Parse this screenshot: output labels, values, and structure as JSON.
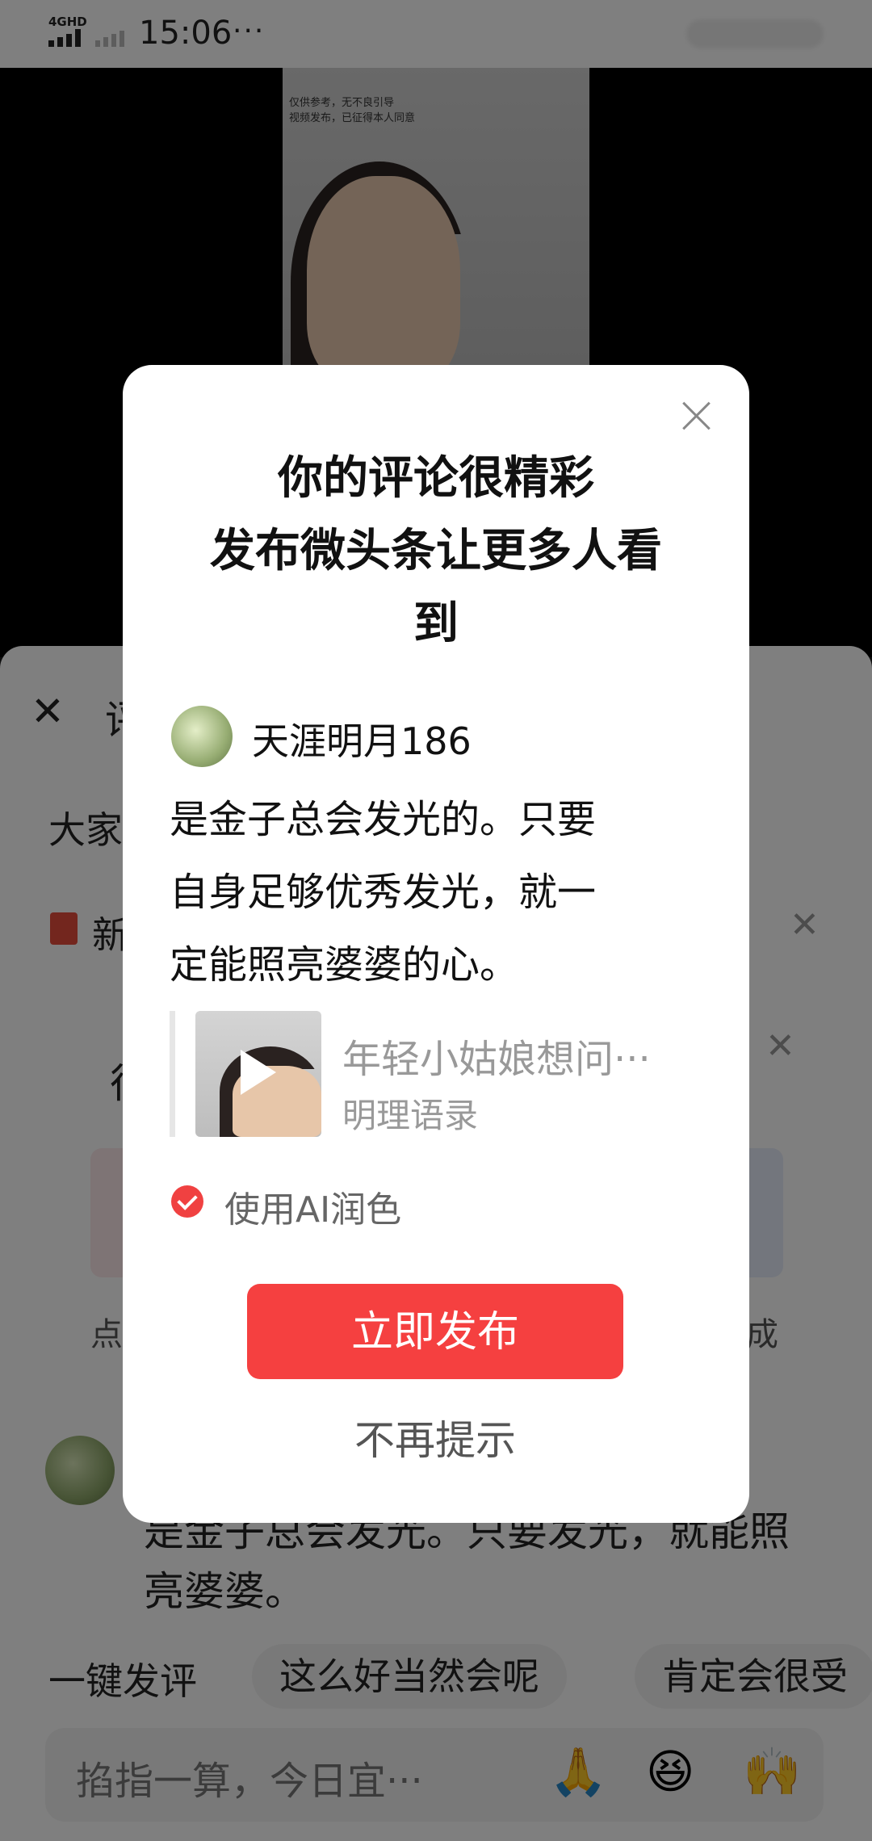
{
  "status_bar": {
    "network": "4GHD",
    "time": "15:06",
    "more": "···"
  },
  "video": {
    "caption_line1": "仅供参考，无不良引导",
    "caption_line2": "视频发布，已征得本人同意"
  },
  "sheet": {
    "close_icon": "close-icon",
    "title_partial": "评",
    "line1_partial": "大家",
    "promo_partial": "新",
    "card_head_partial": "很",
    "tile_left_partial": "点",
    "tile_right_partial": "成",
    "comment_text": "是金子总会发光。只要发光，就能照亮婆婆。",
    "quick_label": "一键发评",
    "chips": [
      "这么好当然会呢",
      "肯定会很受"
    ],
    "input_placeholder": "掐指一算，今日宜···",
    "emojis": [
      "🙏",
      "😆",
      "🙌"
    ]
  },
  "dialog": {
    "title_line1": "你的评论很精彩",
    "title_line2": "发布微头条让更多人看",
    "title_line3": "到",
    "username": "天涯明月186",
    "body_line1": "是金子总会发光的。只要",
    "body_line2": "自身足够优秀发光，就一",
    "body_line3": "定能照亮婆婆的心。",
    "quote_title": "年轻小姑娘想问···",
    "quote_source": "明理语录",
    "ai_polish_label": "使用AI润色",
    "ai_polish_checked": true,
    "publish_label": "立即发布",
    "dismiss_label": "不再提示",
    "accent_color": "#f54040"
  }
}
